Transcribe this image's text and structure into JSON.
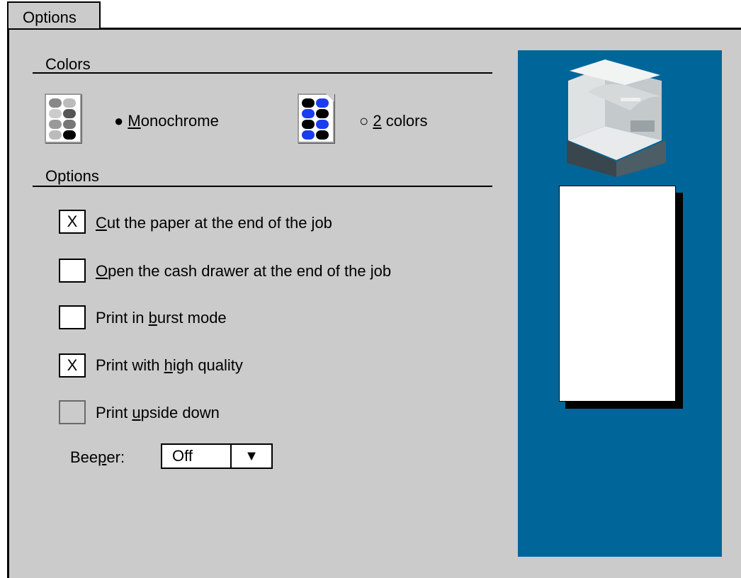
{
  "tab": {
    "label": "Options"
  },
  "colors": {
    "title": "Colors",
    "options": [
      {
        "pre": "● ",
        "ul": "M",
        "post": "onochrome",
        "selected": true,
        "icon": "monochrome-palette-icon"
      },
      {
        "pre": "○ ",
        "ul": "2",
        "post": " colors",
        "selected": false,
        "icon": "two-color-palette-icon"
      }
    ]
  },
  "options": {
    "title": "Options",
    "items": [
      {
        "mark": "X",
        "pre": "",
        "ul": "C",
        "post": "ut the paper at the end of the job",
        "checked": true,
        "enabled": true
      },
      {
        "mark": "",
        "pre": "",
        "ul": "O",
        "post": "pen the cash drawer at the end of the job",
        "checked": false,
        "enabled": true
      },
      {
        "mark": "",
        "pre": "Print in ",
        "ul": "b",
        "post": "urst mode",
        "checked": false,
        "enabled": true
      },
      {
        "mark": "X",
        "pre": "Print with ",
        "ul": "h",
        "post": "igh quality",
        "checked": true,
        "enabled": true
      },
      {
        "mark": "",
        "pre": "Print ",
        "ul": "u",
        "post": "pside down",
        "checked": false,
        "enabled": false
      }
    ]
  },
  "beeper": {
    "pre": "Bee",
    "ul": "p",
    "post": "er:",
    "value": "Off",
    "arrow": "▼"
  },
  "preview": {
    "icons": [
      "printer-icon",
      "paper-preview"
    ]
  },
  "colors_palette": {
    "preview_bg": "#006699",
    "panel_bg": "#cbcbcb"
  }
}
